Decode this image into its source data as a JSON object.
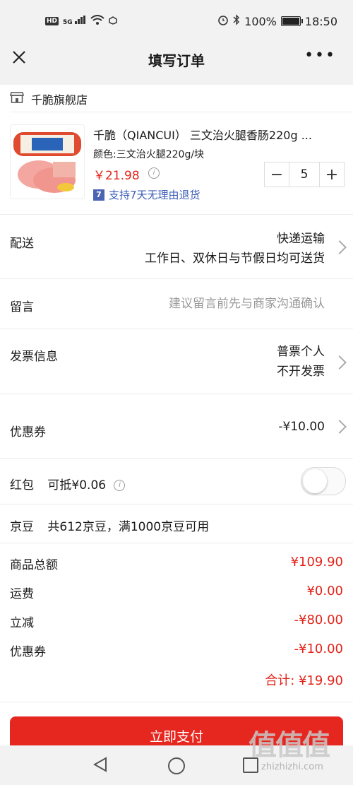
{
  "status_bar": {
    "hd": "HD",
    "signal": "5G",
    "battery": "100%",
    "battery_level": 1.0,
    "time": "18:50",
    "icons": [
      "wifi-icon",
      "vpn-icon",
      "alarm-icon",
      "bluetooth-icon",
      "battery-icon"
    ]
  },
  "header": {
    "title": "填写订单",
    "close_icon": "close-icon",
    "more_icon": "more-icon"
  },
  "store": {
    "name": "千脆旗舰店",
    "icon": "store-icon"
  },
  "product": {
    "title": "千脆（QIANCUI） 三文治火腿香肠220g ...",
    "spec": "颜色:三文治火腿220g/块",
    "price": "￥21.98",
    "quantity": "5",
    "minus": "−",
    "plus": "+",
    "return_badge": "7",
    "return_text": "支持7天无理由退货"
  },
  "delivery": {
    "label": "配送",
    "method": "快递运输",
    "schedule": "工作日、双休日与节假日均可送货"
  },
  "message": {
    "label": "留言",
    "placeholder": "建议留言前先与商家沟通确认"
  },
  "invoice": {
    "label": "发票信息",
    "type": "普票个人",
    "status": "不开发票"
  },
  "coupon": {
    "label": "优惠券",
    "value": "-¥10.00"
  },
  "red_packet": {
    "label": "红包",
    "deductible": "可抵¥0.06",
    "enabled": false
  },
  "jingdou": {
    "label": "京豆",
    "text": "共612京豆，满1000京豆可用"
  },
  "summary": {
    "rows": [
      {
        "label": "商品总额",
        "value": "¥109.90"
      },
      {
        "label": "运费",
        "value": "¥0.00"
      },
      {
        "label": "立减",
        "value": "-¥80.00"
      },
      {
        "label": "优惠券",
        "value": "-¥10.00"
      }
    ],
    "total": "合计: ¥19.90"
  },
  "pay_button": "立即支付",
  "watermark": {
    "logo": "值值值",
    "url": "zhizhizhi.com"
  },
  "colors": {
    "accent": "#e2231a",
    "link_blue": "#3c5db8",
    "background_gray": "#f2f2f2"
  }
}
